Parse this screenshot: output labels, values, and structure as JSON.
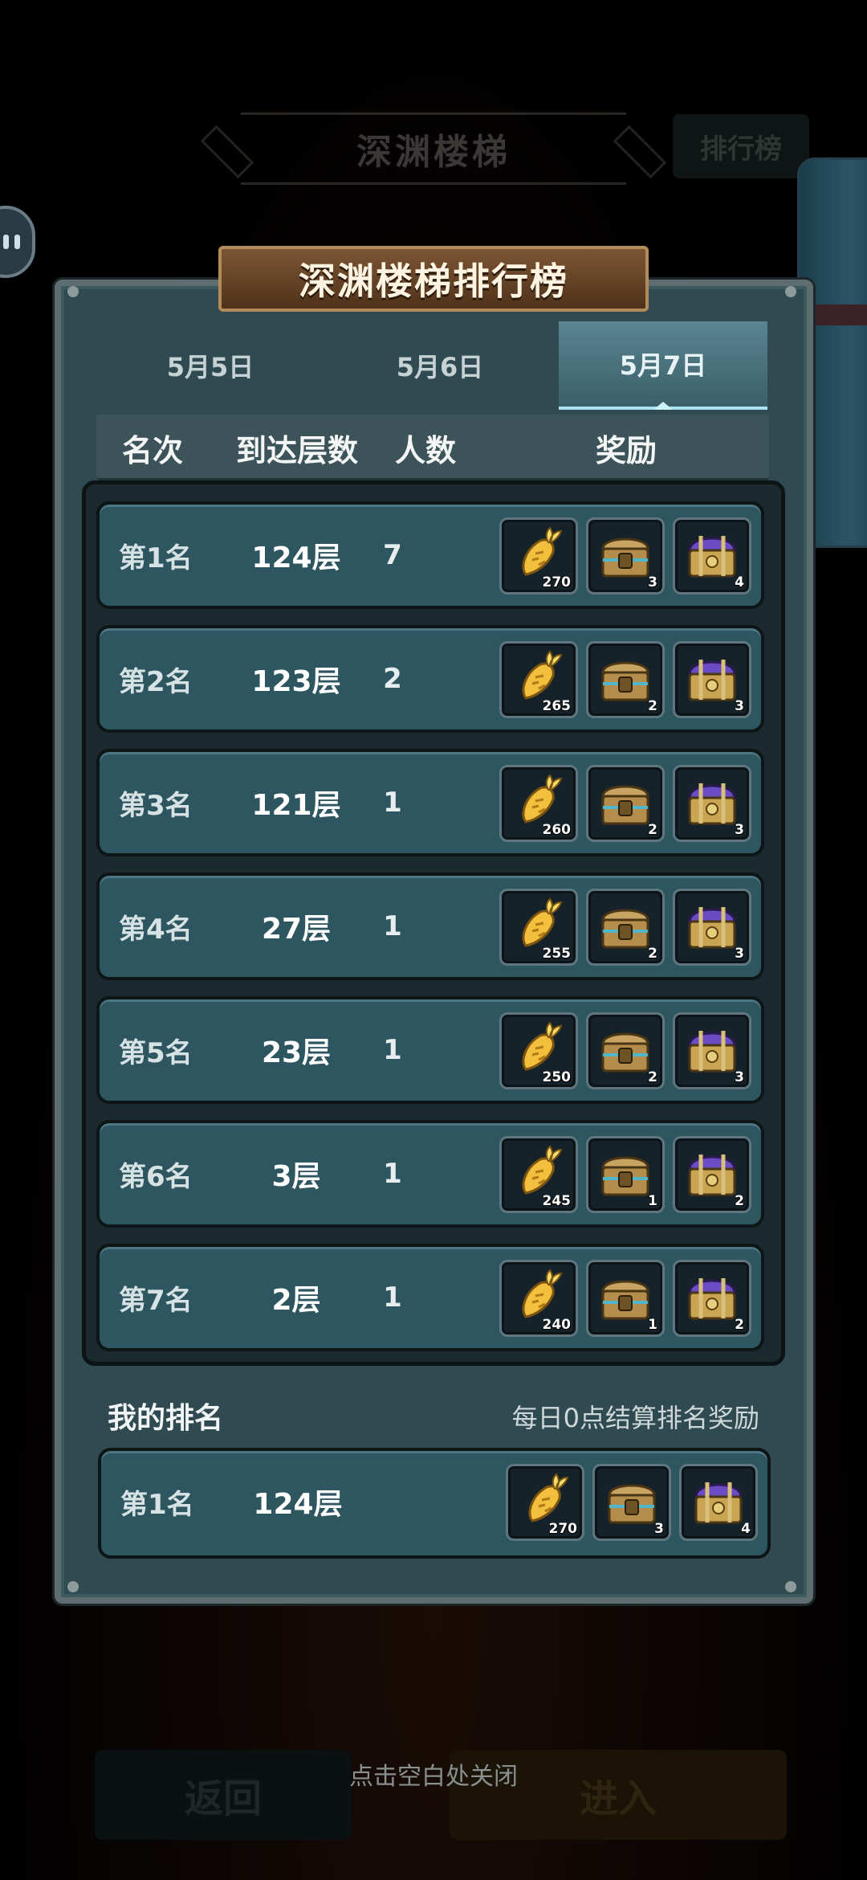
{
  "background": {
    "title": "深渊楼梯",
    "rank_button": "排行榜",
    "back_button": "返回",
    "enter_button": "进入",
    "close_hint": "点击空白处关闭"
  },
  "panel": {
    "title": "深渊楼梯排行榜",
    "tabs": [
      {
        "label": "5月5日",
        "active": false
      },
      {
        "label": "5月6日",
        "active": false
      },
      {
        "label": "5月7日",
        "active": true
      }
    ],
    "headers": {
      "rank": "名次",
      "floor": "到达层数",
      "count": "人数",
      "reward": "奖励"
    }
  },
  "rows": [
    {
      "rank": "第1名",
      "floor": "124层",
      "count": "7",
      "rewards": [
        "270",
        "3",
        "4"
      ]
    },
    {
      "rank": "第2名",
      "floor": "123层",
      "count": "2",
      "rewards": [
        "265",
        "2",
        "3"
      ]
    },
    {
      "rank": "第3名",
      "floor": "121层",
      "count": "1",
      "rewards": [
        "260",
        "2",
        "3"
      ]
    },
    {
      "rank": "第4名",
      "floor": "27层",
      "count": "1",
      "rewards": [
        "255",
        "2",
        "3"
      ]
    },
    {
      "rank": "第5名",
      "floor": "23层",
      "count": "1",
      "rewards": [
        "250",
        "2",
        "3"
      ]
    },
    {
      "rank": "第6名",
      "floor": "3层",
      "count": "1",
      "rewards": [
        "245",
        "1",
        "2"
      ]
    },
    {
      "rank": "第7名",
      "floor": "2层",
      "count": "1",
      "rewards": [
        "240",
        "1",
        "2"
      ]
    }
  ],
  "my_rank": {
    "label": "我的排名",
    "note": "每日0点结算排名奖励",
    "rank": "第1名",
    "floor": "124层",
    "rewards": [
      "270",
      "3",
      "4"
    ]
  },
  "reward_icons": [
    "carrot-icon",
    "treasure-chest-icon",
    "purple-chest-icon"
  ],
  "colors": {
    "panel": "#2f4a50",
    "row": "#2e5660",
    "banner": "#6a4628",
    "active_tab": "#5a8592"
  }
}
